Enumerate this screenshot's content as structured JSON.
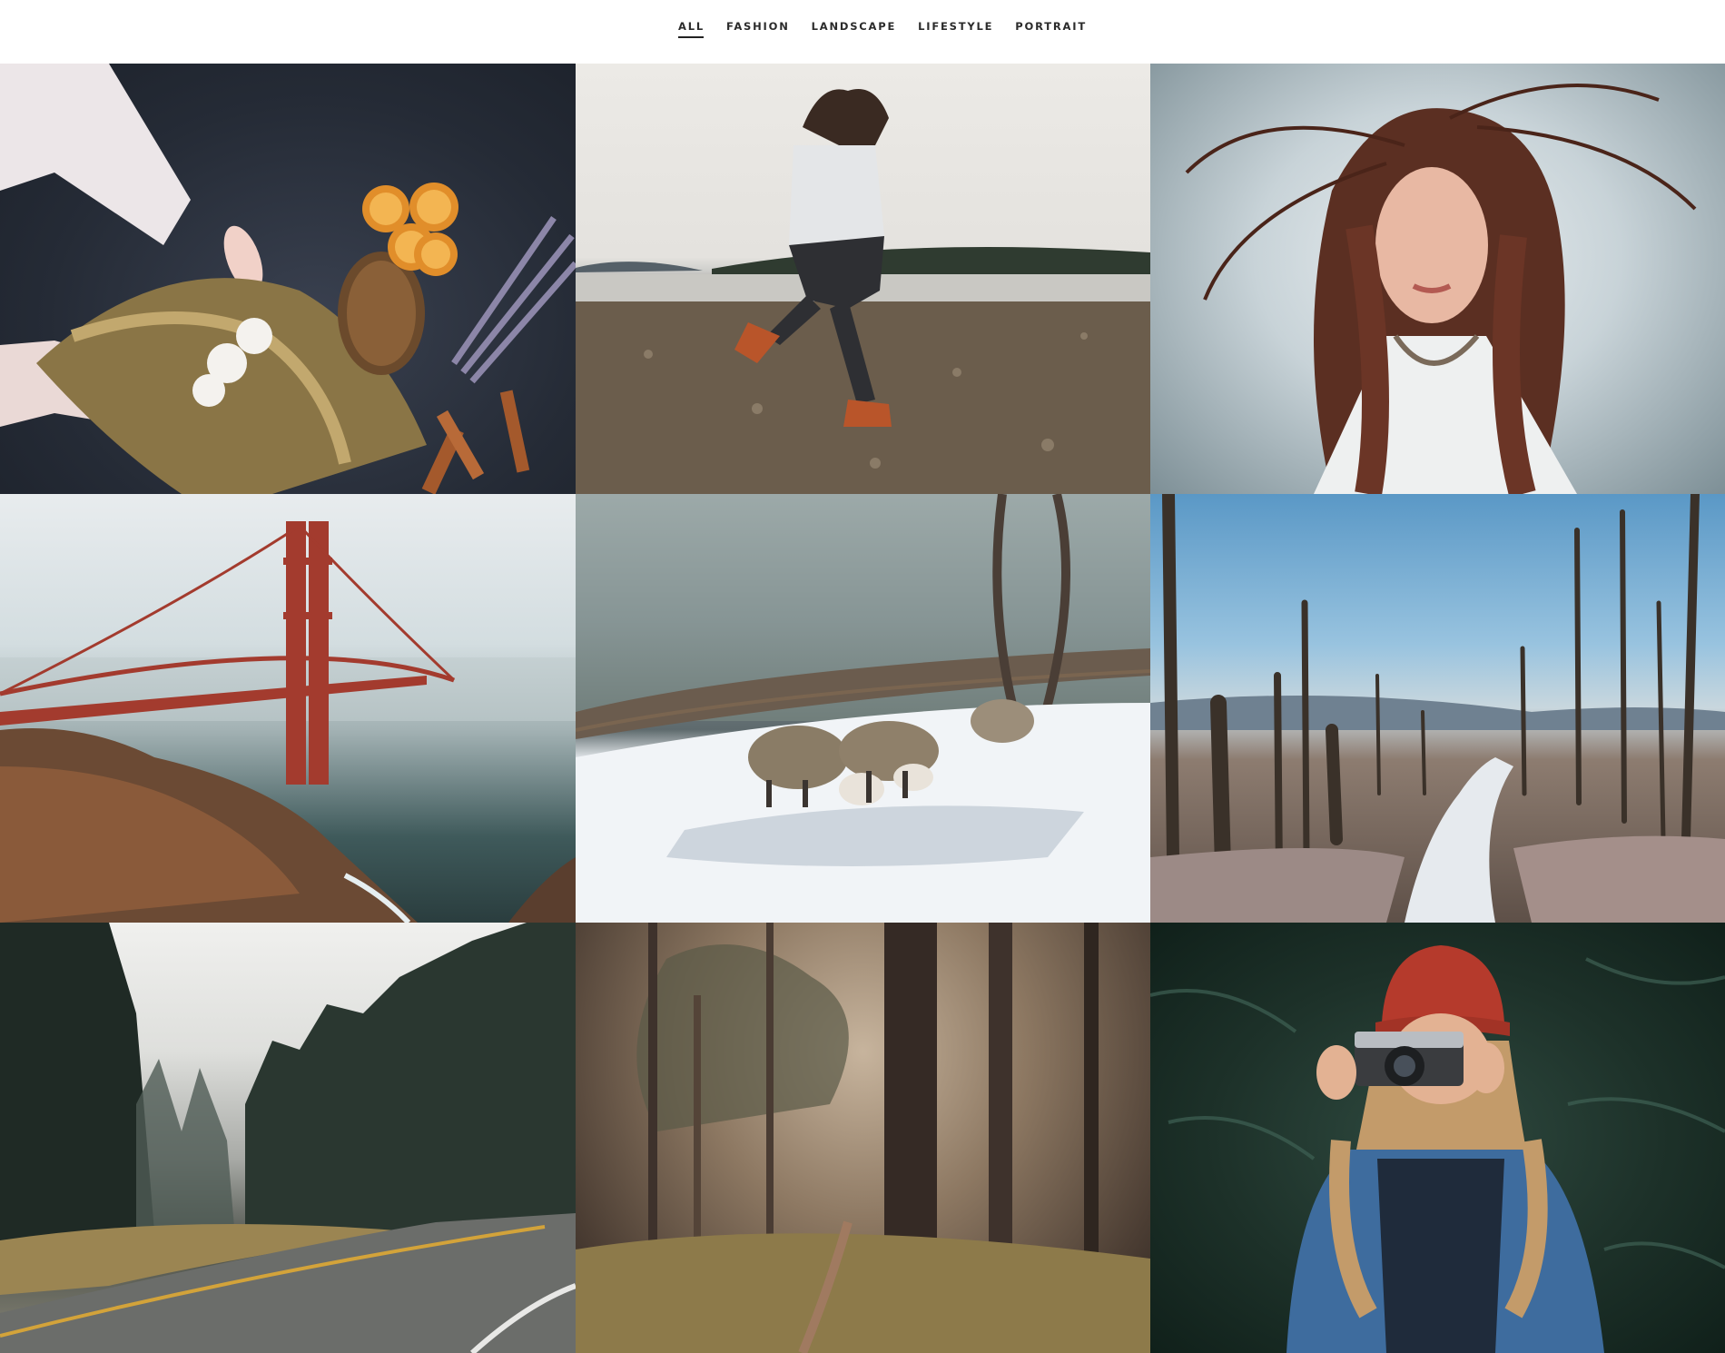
{
  "filters": [
    {
      "label": "ALL",
      "active": true
    },
    {
      "label": "FASHION",
      "active": false
    },
    {
      "label": "LANDSCAPE",
      "active": false
    },
    {
      "label": "LIFESTYLE",
      "active": false
    },
    {
      "label": "PORTRAIT",
      "active": false
    }
  ],
  "gallery": {
    "photos": [
      {
        "subject": "hands arranging dried herbs, oranges, cinnamon, lavender"
      },
      {
        "subject": "person running on pebble beach"
      },
      {
        "subject": "woman with wind-blown red hair"
      },
      {
        "subject": "golden gate bridge in fog"
      },
      {
        "subject": "sheep in snowy pasture"
      },
      {
        "subject": "burned forest with snow path"
      },
      {
        "subject": "winding road through misty pine forest"
      },
      {
        "subject": "foggy forest trail"
      },
      {
        "subject": "woman in red beanie holding camera"
      }
    ]
  }
}
